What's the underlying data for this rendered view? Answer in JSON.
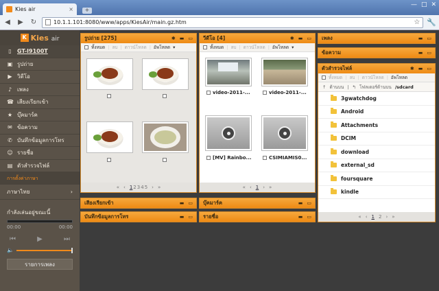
{
  "browser": {
    "tab_title": "Kies air",
    "tab_close": "×",
    "new_tab": "+",
    "url": "10.1.1.101:8080/www/apps/KiesAir/main.gz.htm",
    "back": "◀",
    "forward": "▶",
    "reload": "↻",
    "star": "☆",
    "wrench": "🔧",
    "win_min": "—",
    "win_max": "□",
    "win_close": "✕"
  },
  "logo": {
    "badge": "K",
    "name": "Kies",
    "suffix": "air"
  },
  "sidebar": {
    "device": "GT-I9100T",
    "items": [
      {
        "label": "รูปถ่าย",
        "icon": "photo-icon",
        "glyph": "▣"
      },
      {
        "label": "วิดีโอ",
        "icon": "video-icon",
        "glyph": "▶"
      },
      {
        "label": "เพลง",
        "icon": "music-icon",
        "glyph": "♪"
      },
      {
        "label": "เสียงเรียกเข้า",
        "icon": "ringtone-icon",
        "glyph": "☎"
      },
      {
        "label": "บุ๊คมาร์ค",
        "icon": "bookmark-icon",
        "glyph": "★"
      },
      {
        "label": "ข้อความ",
        "icon": "message-icon",
        "glyph": "✉"
      },
      {
        "label": "บันทึกข้อมูลการโทร",
        "icon": "call-log-icon",
        "glyph": "✆"
      },
      {
        "label": "รายชื่อ",
        "icon": "contacts-icon",
        "glyph": "☺"
      },
      {
        "label": "ตัวสำรวจไฟล์",
        "icon": "file-explorer-icon",
        "glyph": "▤"
      }
    ],
    "section_language": "การตั้งค่าภาษา",
    "language": "ภาษาไทย",
    "now_playing": "กำลังเล่นอยู่ขณะนี้",
    "time_start": "00:00",
    "time_end": "00:00",
    "playlist_button": "รายการเพลง"
  },
  "toolbar_labels": {
    "download": "ทั้งหมด",
    "delete": "ลบ",
    "unselect": "ดาวน์โหลด",
    "upload": "อัพโหลด"
  },
  "panels": {
    "photos": {
      "title": "รูปถ่าย [275]",
      "pages": [
        "1",
        "2",
        "3",
        "4",
        "5"
      ]
    },
    "videos": {
      "title": "วีดีโอ [4]",
      "items": [
        "video-2011-...",
        "video-2011-...",
        "[MV] Rainbo...",
        "CSIMIAMIS0..."
      ],
      "pages": [
        "1"
      ]
    },
    "music": {
      "title": "เพลง"
    },
    "messages": {
      "title": "ข้อความ"
    },
    "files": {
      "title": "ตัวสำรวจไฟล์",
      "path_up": "ด้านบน",
      "path_label": "โฟลเดอร์ด้านบน",
      "path": "/sdcard",
      "folders": [
        "3gwatchdog",
        "Android",
        "Attachments",
        "DCIM",
        "download",
        "external_sd",
        "foursquare",
        "kindle"
      ],
      "pages": [
        "1",
        "2"
      ]
    },
    "ringtones": {
      "title": "เสียงเรียกเข้า"
    },
    "calllog": {
      "title": "บันทึกข้อมูลการโทร"
    },
    "bookmarks": {
      "title": "บุ๊คมาร์ค"
    },
    "contacts": {
      "title": "รายชื่อ"
    }
  },
  "colors": {
    "accent": "#f29a28",
    "sidebar": "#5a5248",
    "workspace": "#3c3c3c"
  }
}
